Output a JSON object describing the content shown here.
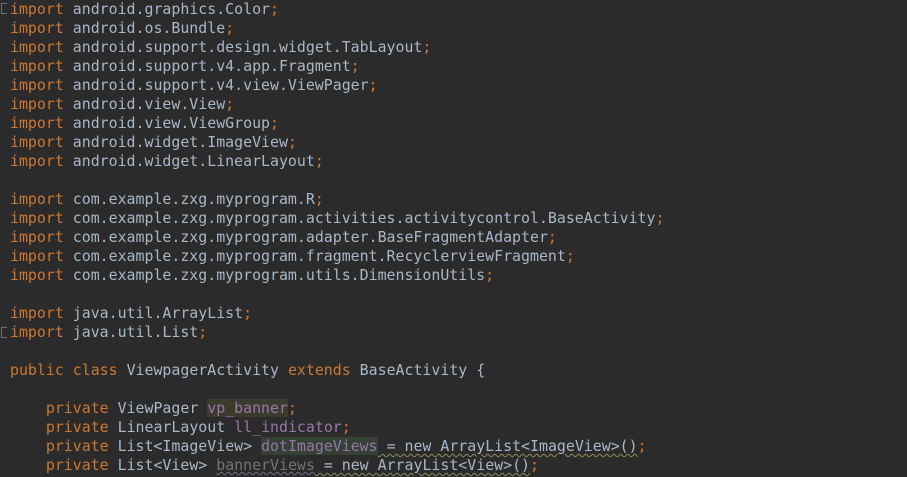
{
  "editor": {
    "imports_group1": [
      "android.graphics.Color",
      "android.os.Bundle",
      "android.support.design.widget.TabLayout",
      "android.support.v4.app.Fragment",
      "android.support.v4.view.ViewPager",
      "android.view.View",
      "android.view.ViewGroup",
      "android.widget.ImageView",
      "android.widget.LinearLayout"
    ],
    "imports_group2": [
      "com.example.zxg.myprogram.R",
      "com.example.zxg.myprogram.activities.activitycontrol.BaseActivity",
      "com.example.zxg.myprogram.adapter.BaseFragmentAdapter",
      "com.example.zxg.myprogram.fragment.RecyclerviewFragment",
      "com.example.zxg.myprogram.utils.DimensionUtils"
    ],
    "imports_group3": [
      "java.util.ArrayList",
      "java.util.List"
    ],
    "keyword_import": "import",
    "semicolon": ";",
    "class_decl": {
      "kw_public": "public",
      "kw_class": "class",
      "name": "ViewpagerActivity",
      "kw_extends": "extends",
      "super": "BaseActivity",
      "brace": "{"
    },
    "fields": [
      {
        "kw": "private",
        "type": "ViewPager",
        "name": "vp_banner",
        "rest": ""
      },
      {
        "kw": "private",
        "type": "LinearLayout",
        "name": "ll_indicator",
        "rest": ""
      },
      {
        "kw": "private",
        "type": "List<ImageView>",
        "name": "dotImageViews",
        "rest": " = new ArrayList<ImageView>()"
      },
      {
        "kw": "private",
        "type": "List<View>",
        "name": "bannerViews",
        "rest": " = new ArrayList<View>()"
      }
    ]
  }
}
